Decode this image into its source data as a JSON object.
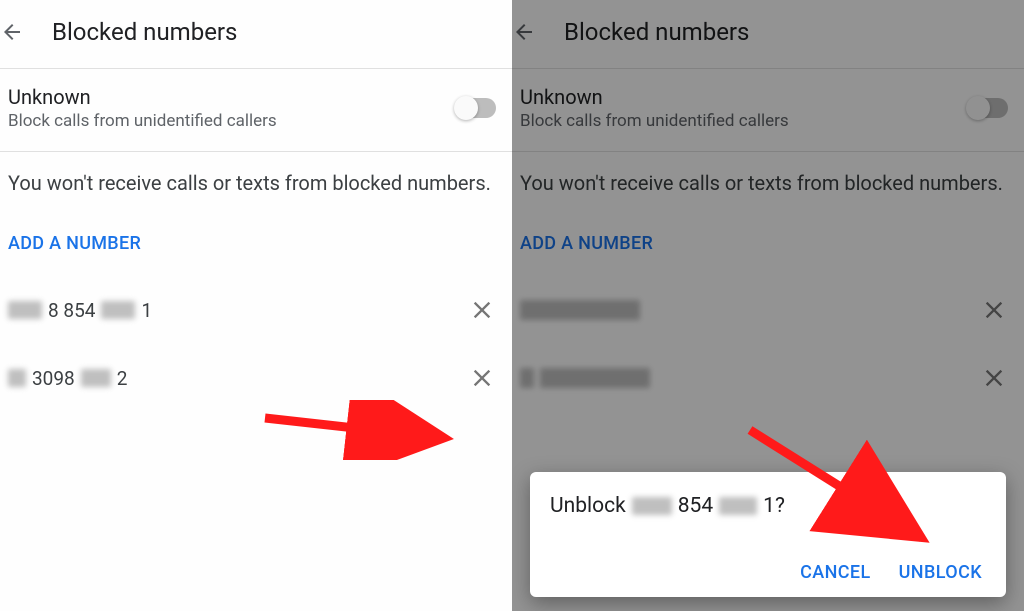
{
  "header": {
    "title": "Blocked numbers"
  },
  "unknown": {
    "title": "Unknown",
    "subtitle": "Block calls from unidentified callers"
  },
  "info_text": "You won't receive calls or texts from blocked numbers.",
  "add_label": "ADD A NUMBER",
  "numbers": {
    "n0_mid": "8 854",
    "n0_end": "1",
    "n1_mid": "3098",
    "n1_end": "2"
  },
  "dialog": {
    "prefix": "Unblock",
    "mid": "854",
    "end": "1?",
    "cancel": "CANCEL",
    "unblock": "UNBLOCK"
  }
}
